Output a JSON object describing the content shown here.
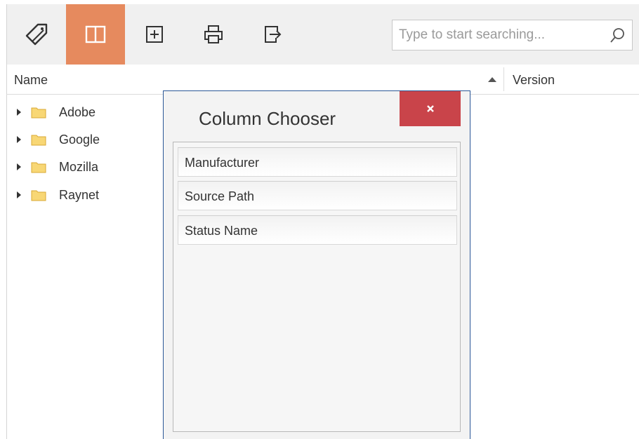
{
  "toolbar": {
    "buttons": [
      {
        "name": "tag-button",
        "icon": "tag-icon",
        "active": false
      },
      {
        "name": "column-chooser-button",
        "icon": "columns-icon",
        "active": true
      },
      {
        "name": "expand-button",
        "icon": "plus-square-icon",
        "active": false
      },
      {
        "name": "print-button",
        "icon": "printer-icon",
        "active": false
      },
      {
        "name": "export-button",
        "icon": "export-icon",
        "active": false
      }
    ],
    "active_color": "#e68a5e",
    "search": {
      "placeholder": "Type to start searching...",
      "value": ""
    }
  },
  "grid": {
    "columns": [
      "Name",
      "Version"
    ],
    "sort": {
      "column": "Name",
      "direction": "ascending"
    },
    "rows": [
      {
        "label": "Adobe",
        "type": "folder",
        "expanded": false
      },
      {
        "label": "Google",
        "type": "folder",
        "expanded": false
      },
      {
        "label": "Mozilla",
        "type": "folder",
        "expanded": false
      },
      {
        "label": "Raynet",
        "type": "folder",
        "expanded": false
      }
    ]
  },
  "dialog": {
    "title": "Column Chooser",
    "close_color": "#c9444a",
    "items": [
      "Manufacturer",
      "Source Path",
      "Status Name"
    ]
  }
}
